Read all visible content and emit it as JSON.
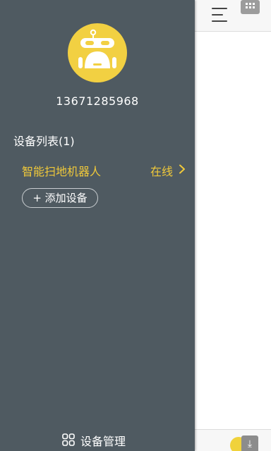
{
  "drawer": {
    "phone": "13671285968",
    "device_list_title": "设备列表(1)",
    "devices": [
      {
        "name": "智能扫地机器人",
        "status": "在线"
      }
    ],
    "add_device_label": "+ 添加设备",
    "bottom_nav_label": "设备管理"
  },
  "colors": {
    "drawer_bg": "#4f5a61",
    "accent_yellow": "#f0c93a",
    "avatar_bg": "#f2d042"
  },
  "icons": {
    "avatar": "robot-icon",
    "menu": "menu-icon",
    "apps": "grid-icon",
    "chevron": "chevron-right-icon",
    "device_manage": "four-squares-icon",
    "download": "download-icon"
  }
}
